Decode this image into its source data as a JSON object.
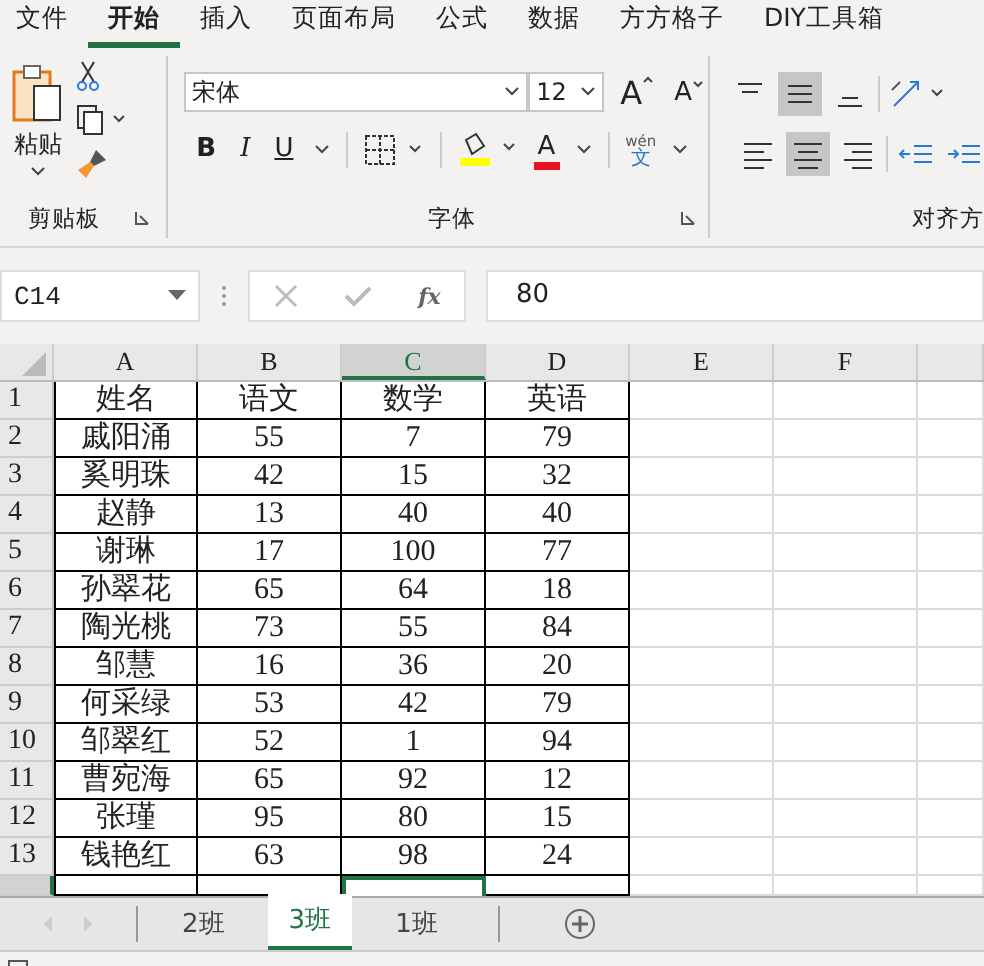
{
  "tabs": [
    {
      "label": "文件",
      "selected": false
    },
    {
      "label": "开始",
      "selected": true
    },
    {
      "label": "插入",
      "selected": false
    },
    {
      "label": "页面布局",
      "selected": false
    },
    {
      "label": "公式",
      "selected": false
    },
    {
      "label": "数据",
      "selected": false
    },
    {
      "label": "方方格子",
      "selected": false
    },
    {
      "label": "DIY工具箱",
      "selected": false
    }
  ],
  "ribbon": {
    "clipboard": {
      "paste": "粘贴",
      "label": "剪贴板"
    },
    "font": {
      "name": "宋体",
      "size": "12",
      "grow": "A",
      "shrink": "A",
      "bold": "B",
      "italic": "I",
      "underline": "U",
      "color_letter": "A",
      "phonetic_top": "wén",
      "phonetic_bottom": "文",
      "label": "字体"
    },
    "alignment": {
      "label": "对齐方"
    }
  },
  "name_box": "C14",
  "fx": "fx",
  "formula": "80",
  "columns": [
    {
      "label": "A",
      "selected": false
    },
    {
      "label": "B",
      "selected": false
    },
    {
      "label": "C",
      "selected": true
    },
    {
      "label": "D",
      "selected": false
    },
    {
      "label": "E",
      "selected": false
    },
    {
      "label": "F",
      "selected": false
    }
  ],
  "rows": [
    {
      "num": "1",
      "cells": [
        "姓名",
        "语文",
        "数学",
        "英语"
      ]
    },
    {
      "num": "2",
      "cells": [
        "戚阳涌",
        "55",
        "7",
        "79"
      ]
    },
    {
      "num": "3",
      "cells": [
        "奚明珠",
        "42",
        "15",
        "32"
      ]
    },
    {
      "num": "4",
      "cells": [
        "赵静",
        "13",
        "40",
        "40"
      ]
    },
    {
      "num": "5",
      "cells": [
        "谢琳",
        "17",
        "100",
        "77"
      ]
    },
    {
      "num": "6",
      "cells": [
        "孙翠花",
        "65",
        "64",
        "18"
      ]
    },
    {
      "num": "7",
      "cells": [
        "陶光桃",
        "73",
        "55",
        "84"
      ]
    },
    {
      "num": "8",
      "cells": [
        "邹慧",
        "16",
        "36",
        "20"
      ]
    },
    {
      "num": "9",
      "cells": [
        "何采绿",
        "53",
        "42",
        "79"
      ]
    },
    {
      "num": "10",
      "cells": [
        "邹翠红",
        "52",
        "1",
        "94"
      ]
    },
    {
      "num": "11",
      "cells": [
        "曹宛海",
        "65",
        "92",
        "12"
      ]
    },
    {
      "num": "12",
      "cells": [
        "张瑾",
        "95",
        "80",
        "15"
      ]
    },
    {
      "num": "13",
      "cells": [
        "钱艳红",
        "63",
        "98",
        "24"
      ]
    }
  ],
  "sheets": [
    {
      "label": "2班",
      "selected": false
    },
    {
      "label": "3班",
      "selected": true
    },
    {
      "label": "1班",
      "selected": false
    }
  ]
}
